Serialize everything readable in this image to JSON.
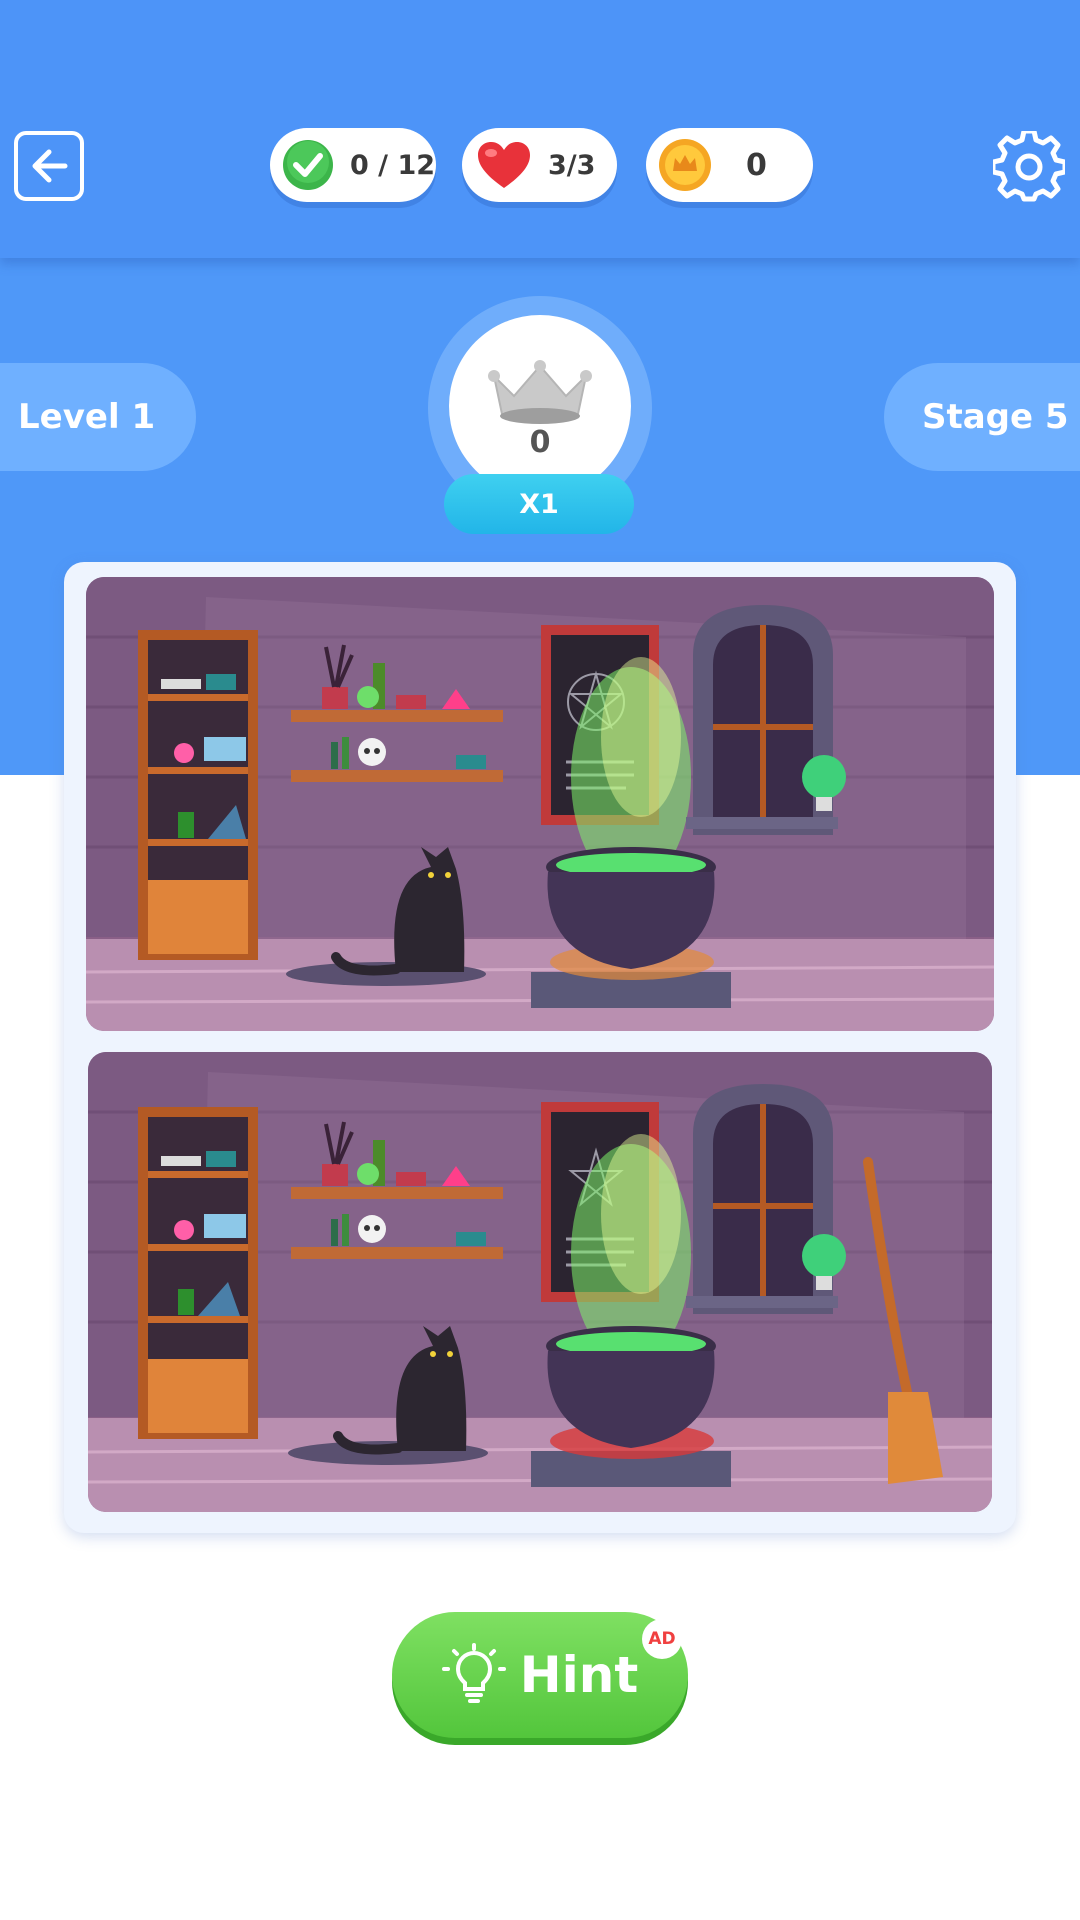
{
  "header": {
    "progress": "0 / 12",
    "lives": "3/3",
    "coins": "0"
  },
  "level_label": "Level 1",
  "stage_label": "Stage 5",
  "crown": {
    "count": "0",
    "multiplier": "X1"
  },
  "hint": {
    "label": "Hint",
    "badge": "AD"
  },
  "colors": {
    "header": "#4d94f8",
    "hint": "#5cc844",
    "multiplier": "#2bbfe9"
  },
  "icons": [
    "back-arrow-icon",
    "check-icon",
    "heart-icon",
    "coin-icon",
    "gear-icon",
    "crown-icon",
    "lightbulb-icon"
  ]
}
